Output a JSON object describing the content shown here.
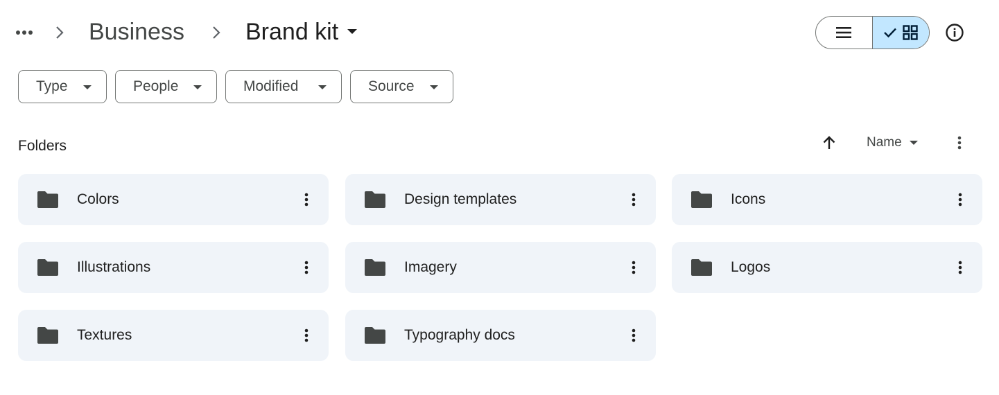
{
  "breadcrumb": {
    "more_icon": "more-horiz-icon",
    "separator_icon": "chevron-right-icon",
    "parent": "Business",
    "current": "Brand kit",
    "current_dropdown_icon": "arrow-drop-down-icon"
  },
  "view_toggle": {
    "list_icon": "list-view-icon",
    "grid_icon": "grid-view-icon",
    "selected_icon": "check-icon",
    "selected": "grid"
  },
  "info_icon": "info-icon",
  "filters": [
    {
      "label": "Type"
    },
    {
      "label": "People"
    },
    {
      "label": "Modified"
    },
    {
      "label": "Source"
    }
  ],
  "section": {
    "title": "Folders",
    "sort_direction_icon": "arrow-upward-icon",
    "sort_label": "Name",
    "more_icon": "more-vert-icon"
  },
  "folders": [
    {
      "name": "Colors"
    },
    {
      "name": "Design templates"
    },
    {
      "name": "Icons"
    },
    {
      "name": "Illustrations"
    },
    {
      "name": "Imagery"
    },
    {
      "name": "Logos"
    },
    {
      "name": "Textures"
    },
    {
      "name": "Typography docs"
    }
  ],
  "colors": {
    "selected_segment": "#c2e7ff",
    "folder_card": "#f0f4f9",
    "icon": "#444746"
  }
}
